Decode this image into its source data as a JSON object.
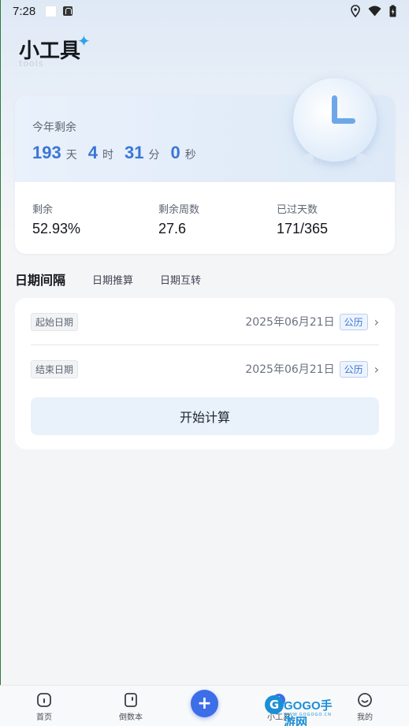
{
  "status_bar": {
    "time": "7:28"
  },
  "header": {
    "title": "小工具",
    "subtitle": "tools"
  },
  "year_card": {
    "remaining_label": "今年剩余",
    "countdown": [
      {
        "value": "193",
        "unit": "天"
      },
      {
        "value": "4",
        "unit": "时"
      },
      {
        "value": "31",
        "unit": "分"
      },
      {
        "value": "0",
        "unit": "秒"
      }
    ],
    "stats": [
      {
        "label": "剩余",
        "value": "52.93%"
      },
      {
        "label": "剩余周数",
        "value": "27.6"
      },
      {
        "label": "已过天数",
        "value": "171/365"
      }
    ],
    "progress_remaining_percent": 52.93
  },
  "tabs": [
    {
      "label": "日期间隔",
      "active": true
    },
    {
      "label": "日期推算",
      "active": false
    },
    {
      "label": "日期互转",
      "active": false
    }
  ],
  "date_interval": {
    "start": {
      "label": "起始日期",
      "value": "2025年06月21日",
      "calendar": "公历"
    },
    "end": {
      "label": "结束日期",
      "value": "2025年06月21日",
      "calendar": "公历"
    },
    "calculate_button": "开始计算"
  },
  "bottom_nav": [
    {
      "label": "首页",
      "icon": "home-icon"
    },
    {
      "label": "倒数本",
      "icon": "countdown-book-icon"
    },
    {
      "label": "小工具",
      "icon": "tools-icon"
    },
    {
      "label": "我的",
      "icon": "smile-icon"
    }
  ],
  "watermark": {
    "brand": "GOGO手游网",
    "url": "WWW.GOGOGO.CN"
  },
  "colors": {
    "accent": "#3a76d6",
    "fab": "#3d6ee8",
    "badge_blue": "#3a76d6"
  }
}
